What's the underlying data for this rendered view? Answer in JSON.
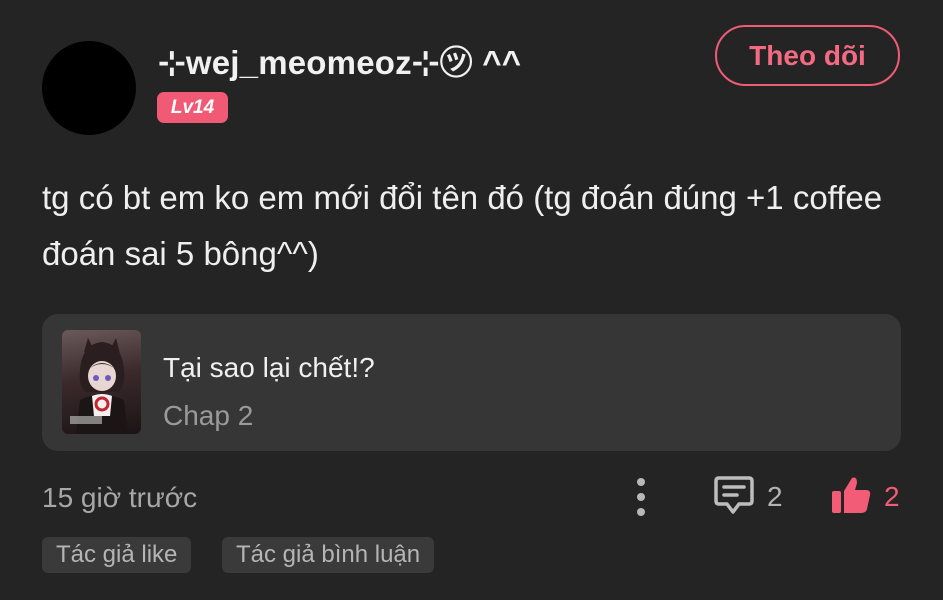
{
  "user": {
    "name": "⊹wej_meomeoz⊹㋡ ^^",
    "level": "Lv14",
    "avatar_color": "#000000"
  },
  "follow_button": {
    "label": "Theo dõi",
    "color": "#f25b76"
  },
  "comment": {
    "text": "tg có bt em ko em mới đổi tên đó (tg đoán đúng +1 coffee đoán sai 5 bông^^)"
  },
  "chapter_card": {
    "title": "Tại sao lại chết!?",
    "subtitle": "Chap 2"
  },
  "meta": {
    "timestamp": "15 giờ trước",
    "comment_count": "2",
    "like_count": "2",
    "more_icon": "more-vertical-icon",
    "comment_icon": "comment-icon",
    "like_icon": "thumbs-up-icon",
    "like_color": "#f25c77"
  },
  "tags": [
    "Tác giả like",
    "Tác giả bình luận"
  ]
}
